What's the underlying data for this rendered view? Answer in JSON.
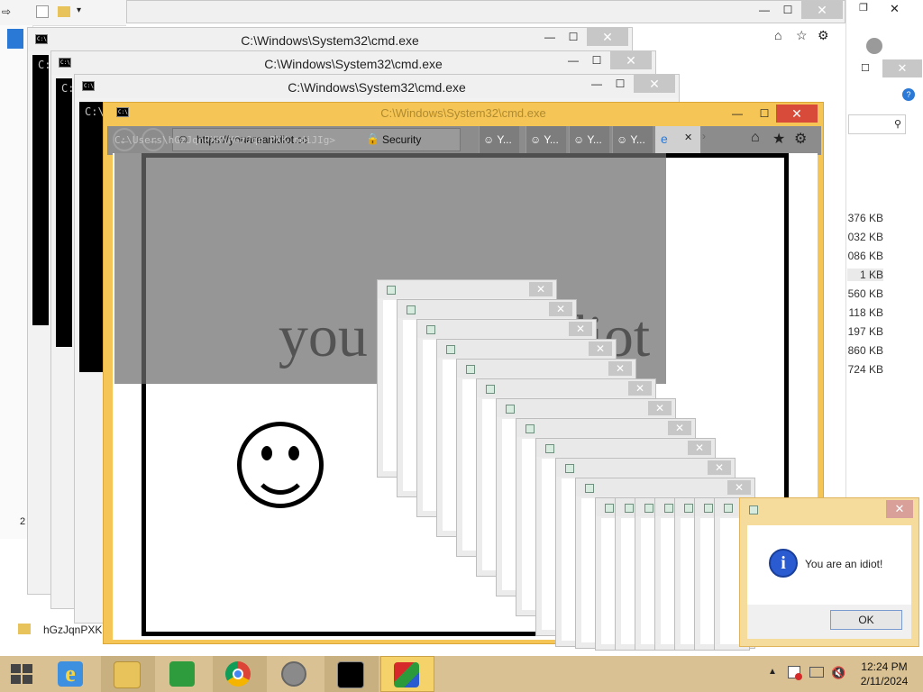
{
  "windows": {
    "cmd_title": "C:\\Windows\\System32\\cmd.exe",
    "cmd_prompt": "C:\\",
    "cmd_prompt2": "C:\\U",
    "cmd_path_overlay": "C:\\Users\\hGzJqnPXK\\HGzJqn PXK.ndiJIg>",
    "minimize": "—",
    "maximize": "☐",
    "close": "✕",
    "restore": "❐"
  },
  "browser": {
    "url": "https://youareanidiot.cc",
    "security": "Security",
    "tabs": [
      "Y...",
      "Y...",
      "Y...",
      "Y..."
    ],
    "icons": [
      "home-icon",
      "star-icon",
      "gear-icon"
    ],
    "accent": "#f5c656"
  },
  "page": {
    "headline": "you are an idiot",
    "smiley": "☺"
  },
  "explorer": {
    "status": "2 it",
    "file_label": "hGzJqnPXK",
    "sizes": [
      "376 KB",
      "032 KB",
      "086 KB",
      "1 KB",
      "560 KB",
      "118 KB",
      "197 KB",
      "860 KB",
      "724 KB"
    ]
  },
  "dialog": {
    "message": "You are an idiot!",
    "ok": "OK",
    "info": "i"
  },
  "taskbar": {
    "time": "12:24 PM",
    "date": "2/11/2024",
    "apps": [
      "start-icon",
      "ie-icon",
      "file-explorer-icon",
      "store-icon",
      "chrome-icon",
      "safari-icon",
      "cmd-icon",
      "app-cube-icon"
    ],
    "color": "#d9c193"
  }
}
